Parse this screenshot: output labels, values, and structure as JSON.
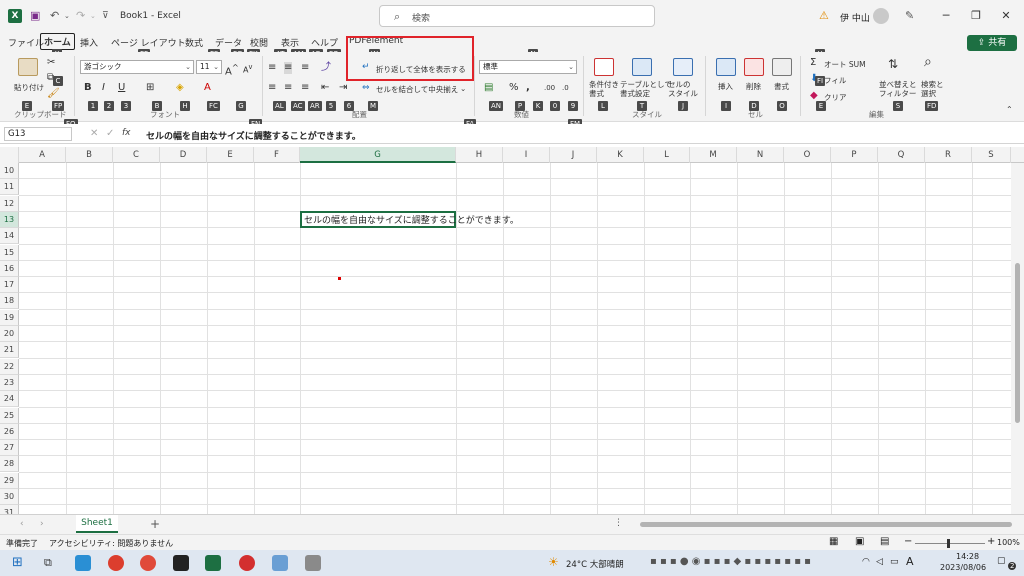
{
  "titlebar": {
    "logo": "X",
    "doc_title": "Book1  -  Excel",
    "search_placeholder": "検索",
    "user_name": "伊 中山",
    "warning_icon": "warning-icon",
    "save_icon": "save-icon"
  },
  "tabs": [
    "ファイル",
    "ホーム",
    "挿入",
    "ページ レイアウト",
    "数式",
    "データ",
    "校閲",
    "表示",
    "ヘルプ",
    "PDFelement"
  ],
  "share_label": "共有",
  "ribbon": {
    "paste_label": "貼り付け",
    "clipboard_group": "クリップボード",
    "font_name": "游ゴシック",
    "font_size": "11",
    "font_group": "フォント",
    "wrap_text": "折り返して全体を表示する",
    "merge_center": "セルを結合して中央揃え",
    "alignment_group": "配置",
    "number_format": "標準",
    "number_group": "数値",
    "cond_format": "条件付き\n書式",
    "table_format": "テーブルとして\n書式設定",
    "cell_style": "セルの\nスタイル",
    "style_group": "スタイル",
    "insert": "挿入",
    "delete": "削除",
    "format": "書式",
    "cells_group": "セル",
    "autosum": "オート SUM",
    "fill": "フィル",
    "clear": "クリア",
    "sort_filter": "並べ替えと\nフィルター",
    "find_select": "検索と\n選択",
    "edit_group": "編集",
    "bold": "B",
    "italic": "I",
    "underline": "U"
  },
  "keytips": [
    "F",
    "H",
    "N",
    "P",
    "M",
    "A",
    "R",
    "W",
    "Y",
    "E",
    "X",
    "C",
    "V",
    "FP",
    "FO",
    "FF",
    "FS",
    "FG",
    "FK",
    "1",
    "2",
    "3",
    "B",
    "H",
    "FC",
    "G",
    "FN",
    "AT",
    "AM",
    "AB",
    "FQ",
    "AL",
    "AC",
    "AR",
    "5",
    "6",
    "M",
    "W",
    "N",
    "AN",
    "P",
    "K",
    "0",
    "9",
    "FA",
    "FM",
    "L",
    "T",
    "J",
    "I",
    "D",
    "O",
    "U",
    "FI",
    "E",
    "S",
    "FD"
  ],
  "formula_bar": {
    "name_box": "G13",
    "fx": "fx",
    "content": "セルの幅を自由なサイズに調整することができます。"
  },
  "columns": [
    "A",
    "B",
    "C",
    "D",
    "E",
    "F",
    "G",
    "H",
    "I",
    "J",
    "K",
    "L",
    "M",
    "N",
    "O",
    "P",
    "Q",
    "R",
    "S"
  ],
  "rows": [
    "10",
    "11",
    "12",
    "13",
    "14",
    "15",
    "16",
    "17",
    "18",
    "19",
    "20",
    "21",
    "22",
    "23",
    "24",
    "25",
    "26",
    "27",
    "28",
    "29",
    "30",
    "31"
  ],
  "selected_cell_text": "セルの幅を自由なサイズに調整することができます。",
  "sheet_tab": "Sheet1",
  "status": {
    "ready": "準備完了",
    "accessibility": "アクセシビリティ: 問題ありません",
    "zoom": "100%"
  },
  "taskbar": {
    "weather": "24°C  大部晴朗",
    "time": "14:28",
    "date": "2023/08/06",
    "notification_count": "2"
  },
  "colors": {
    "excel_green": "#1d6f42",
    "highlight_red": "#e0232a"
  }
}
